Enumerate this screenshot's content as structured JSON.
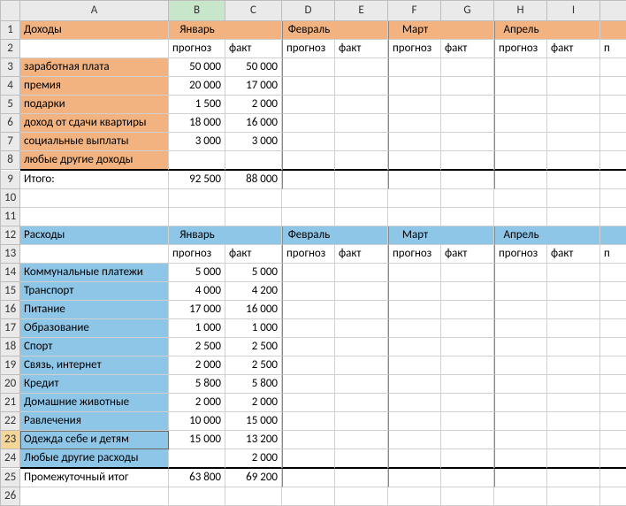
{
  "cols": [
    "A",
    "B",
    "C",
    "D",
    "E",
    "F",
    "G",
    "H",
    "I",
    ""
  ],
  "rows": [
    "1",
    "2",
    "3",
    "4",
    "5",
    "6",
    "7",
    "8",
    "9",
    "10",
    "11",
    "12",
    "13",
    "14",
    "15",
    "16",
    "17",
    "18",
    "19",
    "20",
    "21",
    "22",
    "23",
    "24",
    "25",
    "26"
  ],
  "income": {
    "title": "Доходы",
    "months": [
      "Январь",
      "Февраль",
      "Март",
      "Апрель"
    ],
    "sub": {
      "f": "прогноз",
      "a": "факт"
    },
    "items": [
      {
        "name": "заработная плата",
        "f": "50 000",
        "a": "50 000"
      },
      {
        "name": "премия",
        "f": "20 000",
        "a": "17 000"
      },
      {
        "name": "подарки",
        "f": "1 500",
        "a": "2 000"
      },
      {
        "name": "доход от сдачи квартиры",
        "f": "18 000",
        "a": "16 000"
      },
      {
        "name": "социальные выплаты",
        "f": "3 000",
        "a": "3 000"
      },
      {
        "name": "любые другие доходы",
        "f": "",
        "a": ""
      }
    ],
    "total_label": "Итого:",
    "total": {
      "f": "92 500",
      "a": "88 000"
    }
  },
  "expense": {
    "title": "Расходы",
    "months": [
      "Январь",
      "Февраль",
      "Март",
      "Апрель"
    ],
    "sub": {
      "f": "прогноз",
      "a": "факт"
    },
    "items": [
      {
        "name": "Коммунальные платежи",
        "f": "5 000",
        "a": "5 000"
      },
      {
        "name": "Транспорт",
        "f": "4 000",
        "a": "4 200"
      },
      {
        "name": "Питание",
        "f": "17 000",
        "a": "16 000"
      },
      {
        "name": "Образование",
        "f": "1 000",
        "a": "1 000"
      },
      {
        "name": "Спорт",
        "f": "2 500",
        "a": "2 500"
      },
      {
        "name": "Связь, интернет",
        "f": "2 000",
        "a": "2 500"
      },
      {
        "name": "Кредит",
        "f": "5 800",
        "a": "5 800"
      },
      {
        "name": "Домашние животные",
        "f": "2 000",
        "a": "2 000"
      },
      {
        "name": "Равлечения",
        "f": "10 000",
        "a": "15 000"
      },
      {
        "name": "Одежда себе и детям",
        "f": "15 000",
        "a": "13 200"
      },
      {
        "name": "Любые другие расходы",
        "f": "",
        "a": "2 000"
      }
    ],
    "total_label": "Промежуточный итог",
    "total": {
      "f": "63 800",
      "a": "69 200"
    }
  },
  "partial_col_char": "п"
}
